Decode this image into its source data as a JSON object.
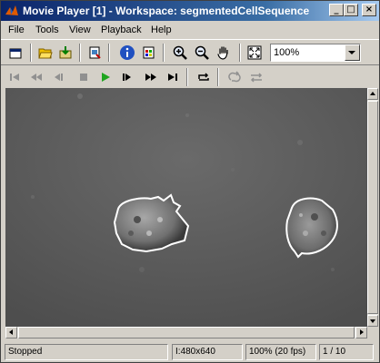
{
  "window": {
    "title": "Movie Player [1] - Workspace: segmentedCellSequence"
  },
  "menu": [
    "File",
    "Tools",
    "View",
    "Playback",
    "Help"
  ],
  "toolbar": {
    "zoom_value": "100%"
  },
  "status": {
    "state": "Stopped",
    "image_type": "I",
    "dimensions": "480x640",
    "zoom_fps": "100% (20 fps)",
    "frame": "1 / 10"
  },
  "colors": {
    "titlebar_start": "#0a246a",
    "titlebar_end": "#a6caf0",
    "play_green": "#1fa51f",
    "cell_outline": "#ffffff"
  },
  "icons": {
    "toolbar1": [
      "new-window-icon",
      "open-icon",
      "import-icon",
      "export-icon",
      "info-icon",
      "colormap-icon",
      "zoom-in-icon",
      "zoom-out-icon",
      "pan-hand-icon",
      "fit-to-window-icon"
    ],
    "toolbar2": [
      "first-frame-icon",
      "rewind-icon",
      "step-back-icon",
      "stop-icon",
      "play-icon",
      "step-forward-icon",
      "fast-forward-icon",
      "last-frame-icon",
      "loop-icon",
      "forward-backward-icon",
      "swap-icon"
    ]
  }
}
